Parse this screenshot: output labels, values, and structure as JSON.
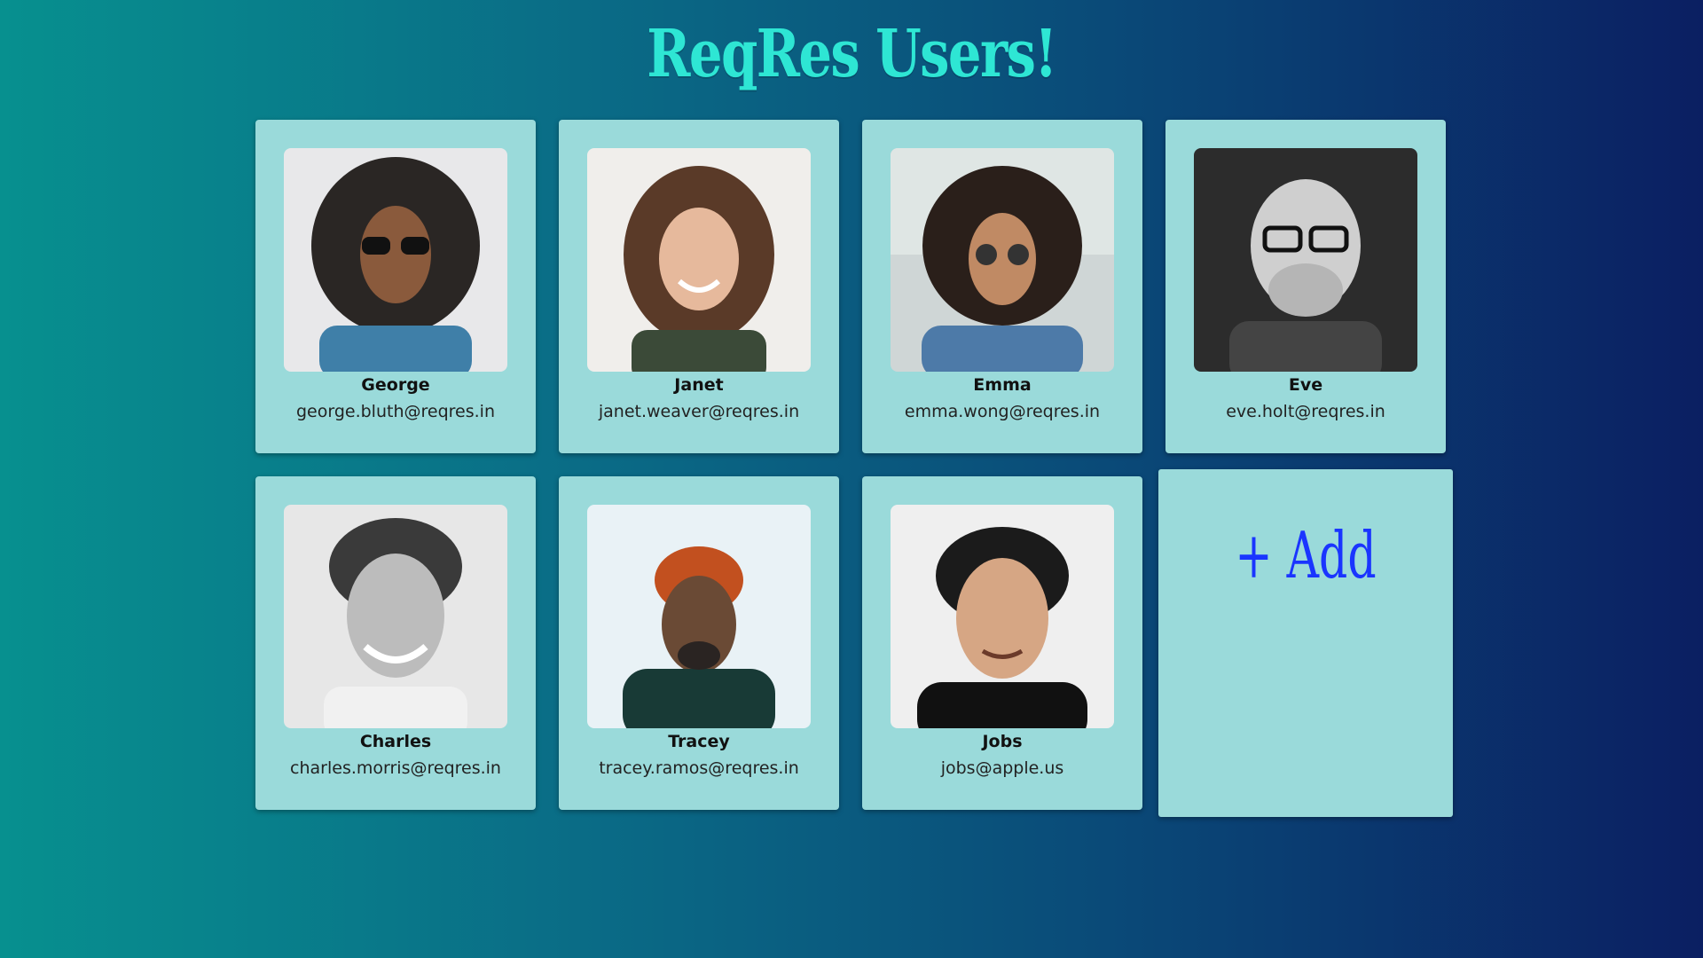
{
  "page": {
    "title": "ReqRes Users!"
  },
  "users": [
    {
      "name": "George",
      "email": "george.bluth@reqres.in",
      "avatar": "person-photo"
    },
    {
      "name": "Janet",
      "email": "janet.weaver@reqres.in",
      "avatar": "person-photo"
    },
    {
      "name": "Emma",
      "email": "emma.wong@reqres.in",
      "avatar": "person-photo"
    },
    {
      "name": "Eve",
      "email": "eve.holt@reqres.in",
      "avatar": "person-photo"
    },
    {
      "name": "Charles",
      "email": "charles.morris@reqres.in",
      "avatar": "person-photo"
    },
    {
      "name": "Tracey",
      "email": "tracey.ramos@reqres.in",
      "avatar": "person-photo"
    },
    {
      "name": "Jobs",
      "email": "jobs@apple.us",
      "avatar": "person-photo"
    }
  ],
  "add_card": {
    "label": "+ Add"
  },
  "colors": {
    "title": "#2ee6d4",
    "card_background": "#9adada",
    "add_label": "#1a35ff",
    "gradient_start": "#07908f",
    "gradient_end": "#0b1f62"
  }
}
